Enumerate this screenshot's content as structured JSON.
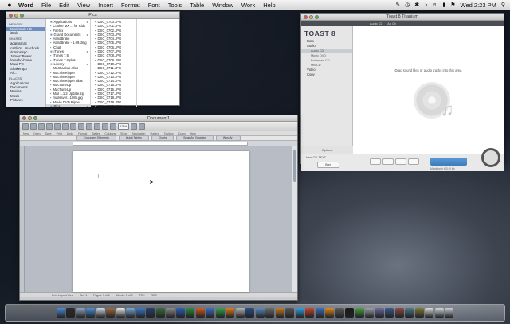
{
  "menubar": {
    "apple": "",
    "items": [
      "Word",
      "File",
      "Edit",
      "View",
      "Insert",
      "Format",
      "Font",
      "Tools",
      "Table",
      "Window",
      "Work",
      "Help"
    ],
    "clock": "Wed 2:23 PM"
  },
  "finder": {
    "title": "Pics",
    "sidebar": [
      {
        "type": "head",
        "label": "DEVICES"
      },
      {
        "type": "item",
        "label": "Macintosh HD"
      },
      {
        "type": "item",
        "label": "iDisk"
      },
      {
        "type": "head",
        "label": "SHARED"
      },
      {
        "type": "item",
        "label": "adamsmac"
      },
      {
        "type": "item",
        "label": "caitlin's ...macbook"
      },
      {
        "type": "item",
        "label": "dominicspc"
      },
      {
        "type": "item",
        "label": "James' Power..."
      },
      {
        "type": "item",
        "label": "loveshq-home"
      },
      {
        "type": "item",
        "label": "Maui-PC"
      },
      {
        "type": "item",
        "label": "Shakerup0"
      },
      {
        "type": "item",
        "label": "All..."
      },
      {
        "type": "head",
        "label": "PLACES"
      },
      {
        "type": "item",
        "label": "Applications"
      },
      {
        "type": "item",
        "label": "Documents"
      },
      {
        "type": "item",
        "label": "Movies"
      },
      {
        "type": "item",
        "label": "Music"
      },
      {
        "type": "item",
        "label": "Pictures"
      }
    ],
    "col1": [
      {
        "label": "Applications",
        "kind": "folder"
      },
      {
        "label": "Cookie MX ... for Kids",
        "kind": "file"
      },
      {
        "label": "Firefox",
        "kind": "file"
      },
      {
        "label": "Grand Documents",
        "kind": "folder"
      },
      {
        "label": "HandBrake",
        "kind": "file"
      },
      {
        "label": "HandBrake - 1.09.dmg",
        "kind": "file"
      },
      {
        "label": "iChat",
        "kind": "file"
      },
      {
        "label": "iTunes",
        "kind": "folder"
      },
      {
        "label": "iTunes 7.6",
        "kind": "file"
      },
      {
        "label": "iTunes 7.6 plus",
        "kind": "file"
      },
      {
        "label": "Library",
        "kind": "folder"
      },
      {
        "label": "MacBackup alias",
        "kind": "file"
      },
      {
        "label": "MacTheRipper",
        "kind": "file"
      },
      {
        "label": "MacTheRipper",
        "kind": "file"
      },
      {
        "label": "MacTheRipper alias",
        "kind": "file"
      },
      {
        "label": "MacTuneUp",
        "kind": "file"
      },
      {
        "label": "MacTuneUp",
        "kind": "file"
      },
      {
        "label": "Mail 1.1.2 Update.zip",
        "kind": "file"
      },
      {
        "label": "mailsaver...1085.jpg",
        "kind": "file"
      },
      {
        "label": "Movie DVD Ripper",
        "kind": "file"
      },
      {
        "label": "Pics",
        "kind": "folder"
      }
    ],
    "col2": [
      "DSC_0700.JPG",
      "DSC_0701.JPG",
      "DSC_0702.JPG",
      "DSC_0703.JPG",
      "DSC_0704.JPG",
      "DSC_0705.JPG",
      "DSC_0706.JPG",
      "DSC_0707.JPG",
      "DSC_0708.JPG",
      "DSC_0709.JPG",
      "DSC_0710.JPG",
      "DSC_0711.JPG",
      "DSC_0712.JPG",
      "DSC_0713.JPG",
      "DSC_0714.JPG",
      "DSC_0715.JPG",
      "DSC_0716.JPG",
      "DSC_0717.JPG",
      "DSC_0718.JPG",
      "DSC_0719.JPG",
      "DSC_0720.JPG"
    ]
  },
  "toast": {
    "title": "Toast 8 Titanium",
    "toptabs": [
      "Audio CD",
      "Au Ch"
    ],
    "logo": "TOAST 8",
    "sidebar": [
      {
        "label": "Data",
        "sub": false,
        "sel": false
      },
      {
        "label": "Audio",
        "sub": false,
        "sel": false
      },
      {
        "label": "Audio CD",
        "sub": true,
        "sel": true
      },
      {
        "label": "Music DVD",
        "sub": true,
        "sel": false
      },
      {
        "label": "Enhanced CD",
        "sub": true,
        "sel": false
      },
      {
        "label": "Mix CD",
        "sub": true,
        "sel": false
      },
      {
        "label": "Video",
        "sub": false,
        "sel": false
      },
      {
        "label": "Copy",
        "sub": false,
        "sel": false
      }
    ],
    "options_label": "Options",
    "hint": "Drag sound files or audio tracks into this area",
    "footer_left": "New CD-TEXT",
    "footer_btn": "Burn",
    "footer_right": "Macintosh HD: 0 kb"
  },
  "word": {
    "title": "Document1",
    "toolbar_labels": [
      "New",
      "Open",
      "Save",
      "Print",
      "Undo",
      "Format",
      "Tables",
      "Columns",
      "Show",
      "Navigation",
      "Gallery",
      "Toolbox",
      "Zoom",
      "Help"
    ],
    "zoom": "125%",
    "ribbon_tabs": [
      "Document Elements",
      "Quick Tables",
      "Charts",
      "SmartArt Graphics",
      "WordArt"
    ],
    "status": [
      "Print Layout View",
      "Sec 1",
      "Pages: 1 of 1",
      "Words: 0 of 0",
      "TRK",
      "REC"
    ]
  },
  "dock": {
    "icons": [
      {
        "name": "finder-icon",
        "color": "#4a8ad8"
      },
      {
        "name": "dashboard-icon",
        "color": "#2b2b2b"
      },
      {
        "name": "mail-icon",
        "color": "#8fa4c2"
      },
      {
        "name": "safari-icon",
        "color": "#4a8fd0"
      },
      {
        "name": "ichat-icon",
        "color": "#cfd7e3"
      },
      {
        "name": "address-book-icon",
        "color": "#9b6b3e"
      },
      {
        "name": "ical-icon",
        "color": "#e8e8e8"
      },
      {
        "name": "preview-icon",
        "color": "#7aa8d8"
      },
      {
        "name": "itunes-icon",
        "color": "#3b78c9"
      },
      {
        "name": "spaces-icon",
        "color": "#2a3e6a"
      },
      {
        "name": "time-machine-icon",
        "color": "#3a6b3a"
      },
      {
        "name": "system-preferences-icon",
        "color": "#8a8a8a"
      },
      {
        "name": "word-icon",
        "color": "#2f5fb8"
      },
      {
        "name": "excel-icon",
        "color": "#2e8a3e"
      },
      {
        "name": "powerpoint-icon",
        "color": "#d25a22"
      },
      {
        "name": "entourage-icon",
        "color": "#3b6fbf"
      },
      {
        "name": "messenger-icon",
        "color": "#36a24e"
      },
      {
        "name": "firefox-icon",
        "color": "#e07a1f"
      },
      {
        "name": "toast-icon",
        "color": "#b5b5b5"
      },
      {
        "name": "photoshop-icon",
        "color": "#2a4e8a"
      },
      {
        "name": "iphoto-icon",
        "color": "#5b8ac0"
      },
      {
        "name": "imovie-icon",
        "color": "#6a6a6a"
      },
      {
        "name": "garageband-icon",
        "color": "#c47a2a"
      },
      {
        "name": "idvd-icon",
        "color": "#555555"
      },
      {
        "name": "skype-icon",
        "color": "#2fa0e0"
      },
      {
        "name": "handbrake-icon",
        "color": "#c8462e"
      },
      {
        "name": "quicktime-icon",
        "color": "#3d6fb8"
      },
      {
        "name": "vlc-icon",
        "color": "#e08a1c"
      },
      {
        "name": "calculator-icon",
        "color": "#5a5a5a"
      },
      {
        "name": "terminal-icon",
        "color": "#1a1a1a"
      },
      {
        "name": "activity-monitor-icon",
        "color": "#48a040"
      },
      {
        "name": "disk-utility-icon",
        "color": "#9aa0a8"
      },
      {
        "name": "app-icon-a",
        "color": "#6b6b9a"
      },
      {
        "name": "app-icon-b",
        "color": "#3a5a8a"
      },
      {
        "name": "app-icon-c",
        "color": "#8a4a4a"
      },
      {
        "name": "app-icon-d",
        "color": "#4a7a8a"
      },
      {
        "name": "app-icon-e",
        "color": "#7a7a3a"
      },
      {
        "name": "documents-stack-icon",
        "color": "#d9d9d9"
      },
      {
        "name": "downloads-stack-icon",
        "color": "#cfd6e0"
      },
      {
        "name": "trash-icon",
        "color": "#c8ccd2"
      }
    ]
  }
}
